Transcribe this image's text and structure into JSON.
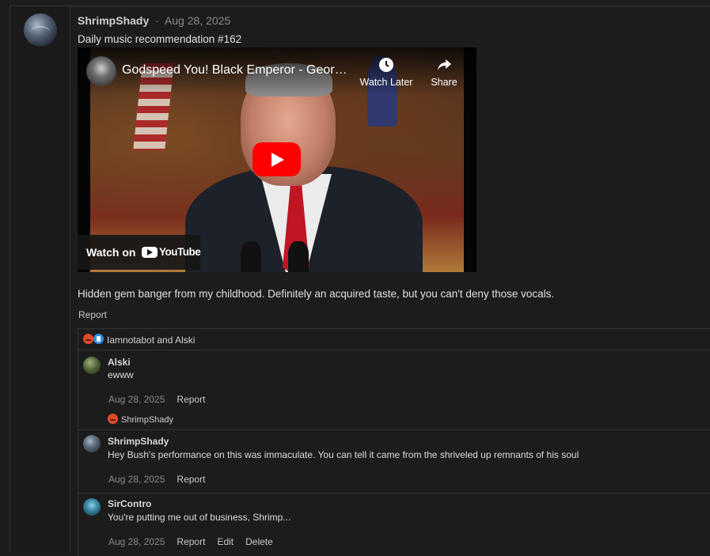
{
  "post": {
    "username": "ShrimpShady",
    "separator": "·",
    "date": "Aug 28, 2025",
    "title": "Daily music recommendation #162",
    "body": "Hidden gem banger from my childhood. Definitely an acquired taste, but you can't deny those vocals.",
    "report_label": "Report"
  },
  "video": {
    "title": "Godspeed You! Black Emperor - Georg...",
    "watch_later_label": "Watch Later",
    "share_label": "Share",
    "watch_on_label": "Watch on",
    "youtube_label": "YouTube",
    "play_color": "#ff0000"
  },
  "reactions": {
    "icons": [
      "angry-emoji",
      "like-emoji"
    ],
    "names": "Iamnotabot and Alski"
  },
  "comments": [
    {
      "username": "Alski",
      "text": "ewww",
      "date": "Aug 28, 2025",
      "actions": [
        "Report"
      ],
      "reaction_icon": "angry-emoji",
      "reaction_names": "ShrimpShady"
    },
    {
      "username": "ShrimpShady",
      "text": "Hey Bush's performance on this was immaculate. You can tell it came from the shriveled up remnants of his soul",
      "date": "Aug 28, 2025",
      "actions": [
        "Report"
      ]
    },
    {
      "username": "SirContro",
      "text": "You're putting me out of business, Shrimp...",
      "date": "Aug 28, 2025",
      "actions": [
        "Report",
        "Edit",
        "Delete"
      ]
    }
  ],
  "colors": {
    "background": "#1c1c1c",
    "border": "#333333",
    "muted_text": "#8a8a8a",
    "youtube_red": "#ff0000"
  }
}
